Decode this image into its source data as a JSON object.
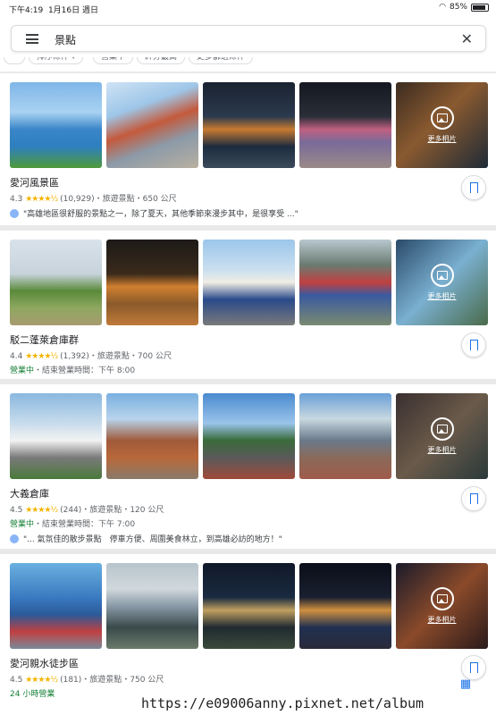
{
  "status_bar": {
    "time": "下午4:19",
    "date": "1月16日 週日",
    "battery": "85%"
  },
  "search": {
    "value": "景點"
  },
  "chips": [
    "排序條件 ▾",
    "營業中",
    "評分最高",
    "更多篩選條件"
  ],
  "more_photos_label": "更多相片",
  "places": [
    {
      "name": "愛河風景區",
      "rating": "4.3",
      "stars": "★★★★½",
      "reviews": "(10,929)",
      "category": "旅遊景點",
      "distance": "650 公尺",
      "review": "\"高雄地區很舒服的景點之一，除了夏天，其他季節來漫步其中，是很享受 ...\""
    },
    {
      "name": "駁二蓬萊倉庫群",
      "rating": "4.4",
      "stars": "★★★★½",
      "reviews": "(1,392)",
      "category": "旅遊景點",
      "distance": "700 公尺",
      "open": "營業中",
      "hours": "・結束營業時間：下午 8:00"
    },
    {
      "name": "大義倉庫",
      "rating": "4.5",
      "stars": "★★★★½",
      "reviews": "(244)",
      "category": "旅遊景點",
      "distance": "120 公尺",
      "open": "營業中",
      "hours": "・結束營業時間：下午 7:00",
      "review": "\"... 氣氛佳的散步景點　停車方便、周圍美食林立，到高雄必訪的地方！\""
    },
    {
      "name": "愛河親水徒步區",
      "rating": "4.5",
      "stars": "★★★★½",
      "reviews": "(181)",
      "category": "旅遊景點",
      "distance": "750 公尺",
      "open": "24 小時營業"
    }
  ],
  "watermark": "https://e09006anny.pixnet.net/album",
  "colors": {
    "accent": "#1a73e8",
    "open": "#188038",
    "star": "#f4b400"
  }
}
